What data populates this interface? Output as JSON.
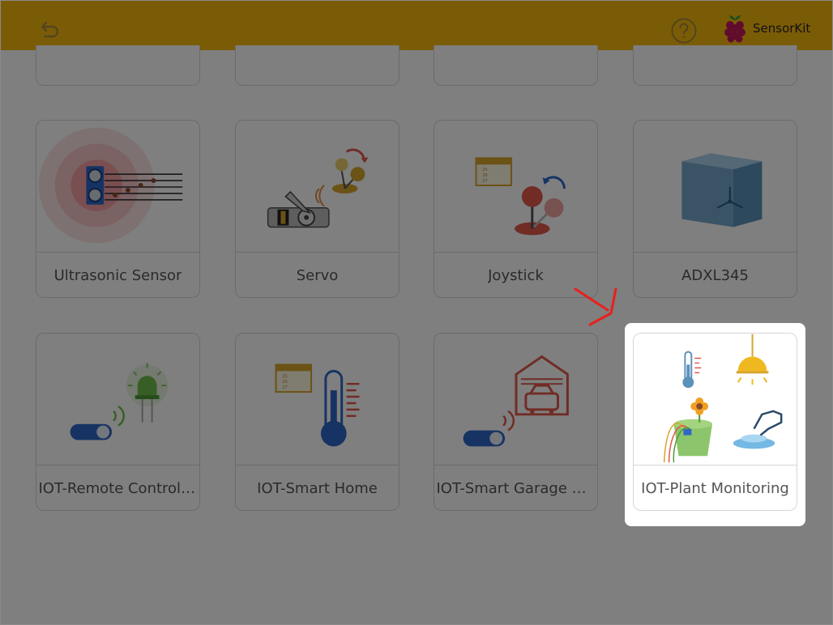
{
  "header": {
    "brand_name": "SensorKit",
    "colors": {
      "header_bg": "#f6b80c",
      "overlay": "rgba(0,0,0,0.5)",
      "arrow": "#e8201c"
    },
    "icons": [
      "back-arrow-icon",
      "help-icon",
      "raspberry-pi-logo"
    ]
  },
  "cards": [
    {
      "label": "Ultrasonic Sensor",
      "icon": "ultrasonic-sensor-illustration"
    },
    {
      "label": "Servo",
      "icon": "servo-illustration"
    },
    {
      "label": "Joystick",
      "icon": "joystick-illustration"
    },
    {
      "label": "ADXL345",
      "icon": "accelerometer-cube-illustration"
    },
    {
      "label": "IOT-Remote Control LED",
      "icon": "remote-led-illustration"
    },
    {
      "label": "IOT-Smart Home",
      "icon": "thermometer-illustration"
    },
    {
      "label": "IOT-Smart Garage Door",
      "icon": "garage-illustration"
    },
    {
      "label": "IOT-Plant Monitoring",
      "icon": "plant-monitoring-illustration"
    }
  ]
}
